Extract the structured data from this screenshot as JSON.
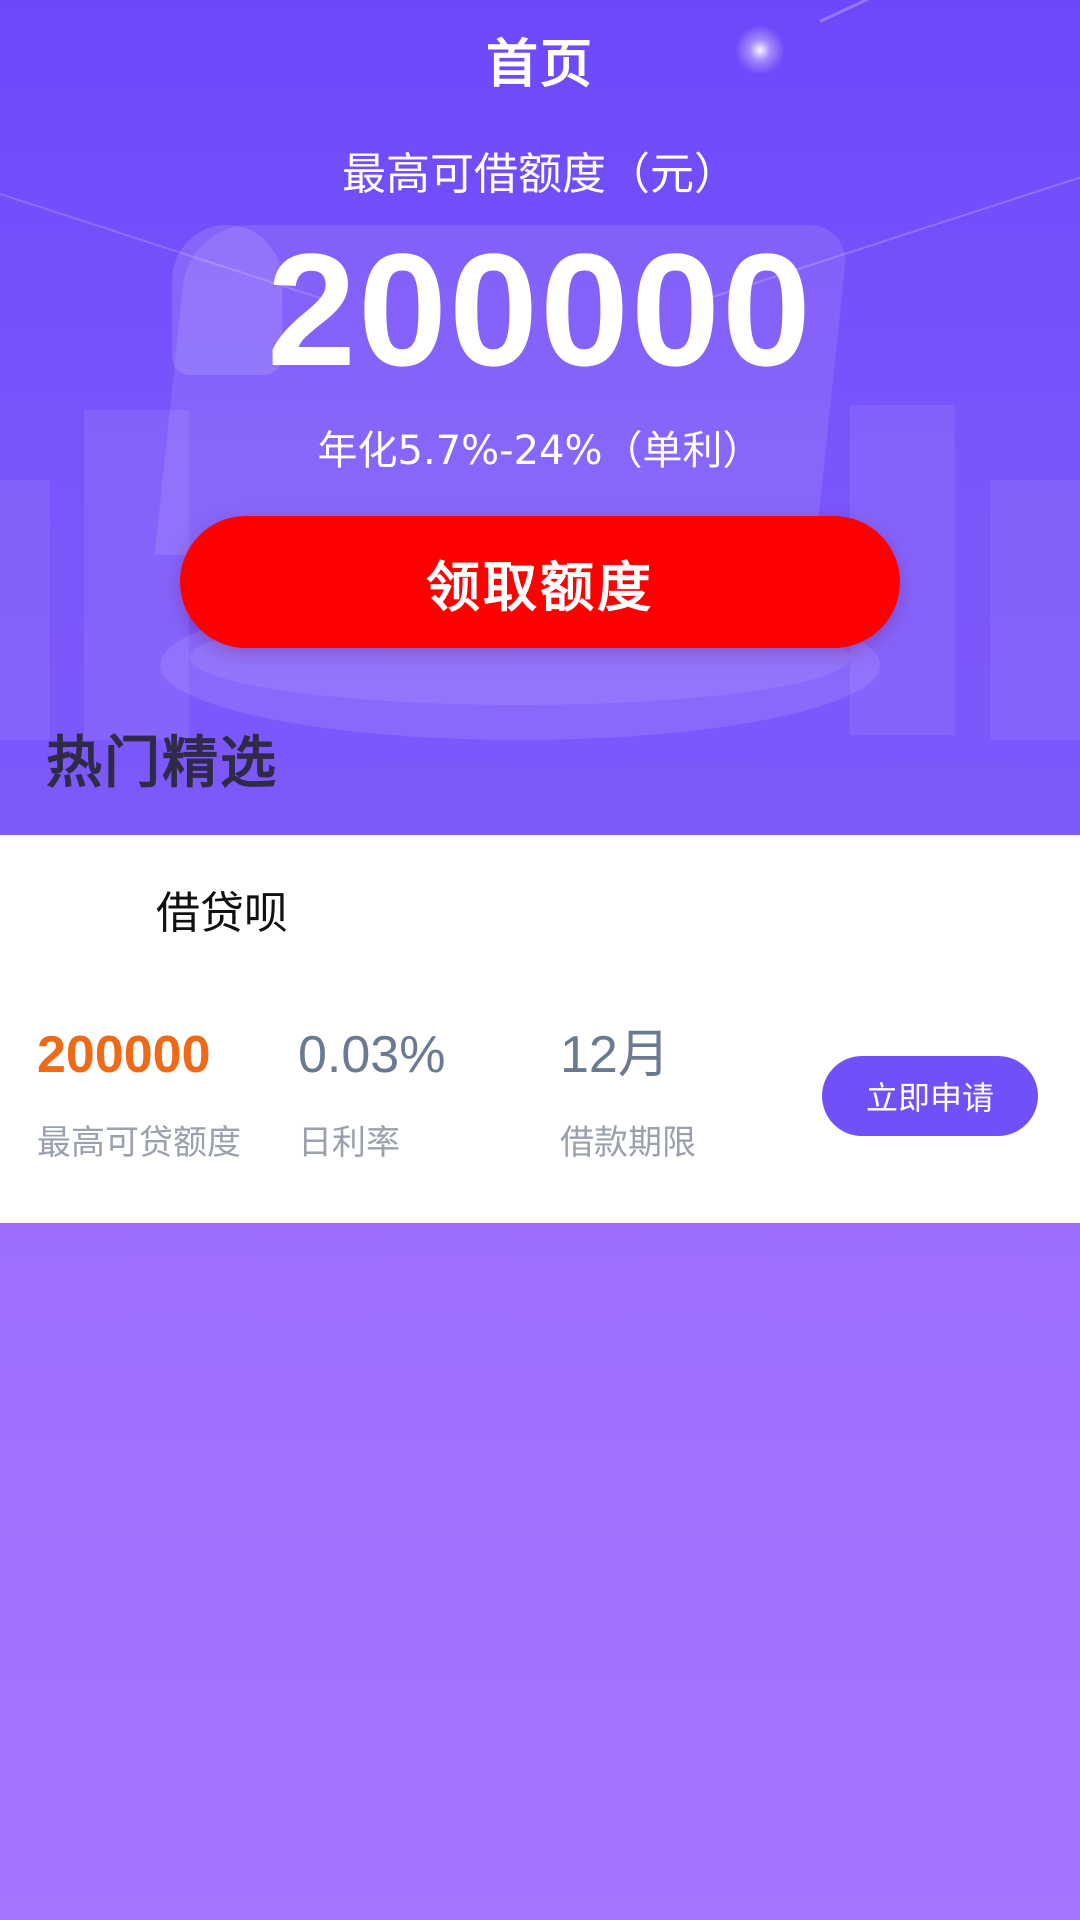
{
  "header": {
    "title": "首页"
  },
  "hero": {
    "limit_label": "最高可借额度（元）",
    "limit_amount": "200000",
    "rate_text": "年化5.7%-24%（单利）",
    "claim_button_label": "领取额度"
  },
  "section": {
    "title": "热门精选"
  },
  "product": {
    "name": "借贷呗",
    "stats": [
      {
        "value": "200000",
        "label": "最高可贷额度"
      },
      {
        "value": "0.03%",
        "label": "日利率"
      },
      {
        "value": "12月",
        "label": "借款期限"
      }
    ],
    "apply_button_label": "立即申请"
  },
  "colors": {
    "hero_purple": "#6d48fa",
    "claim_red": "#ff0000",
    "amount_orange": "#ee6a18",
    "apply_purple": "#7250f8",
    "page_bottom_purple": "#a575ff"
  }
}
